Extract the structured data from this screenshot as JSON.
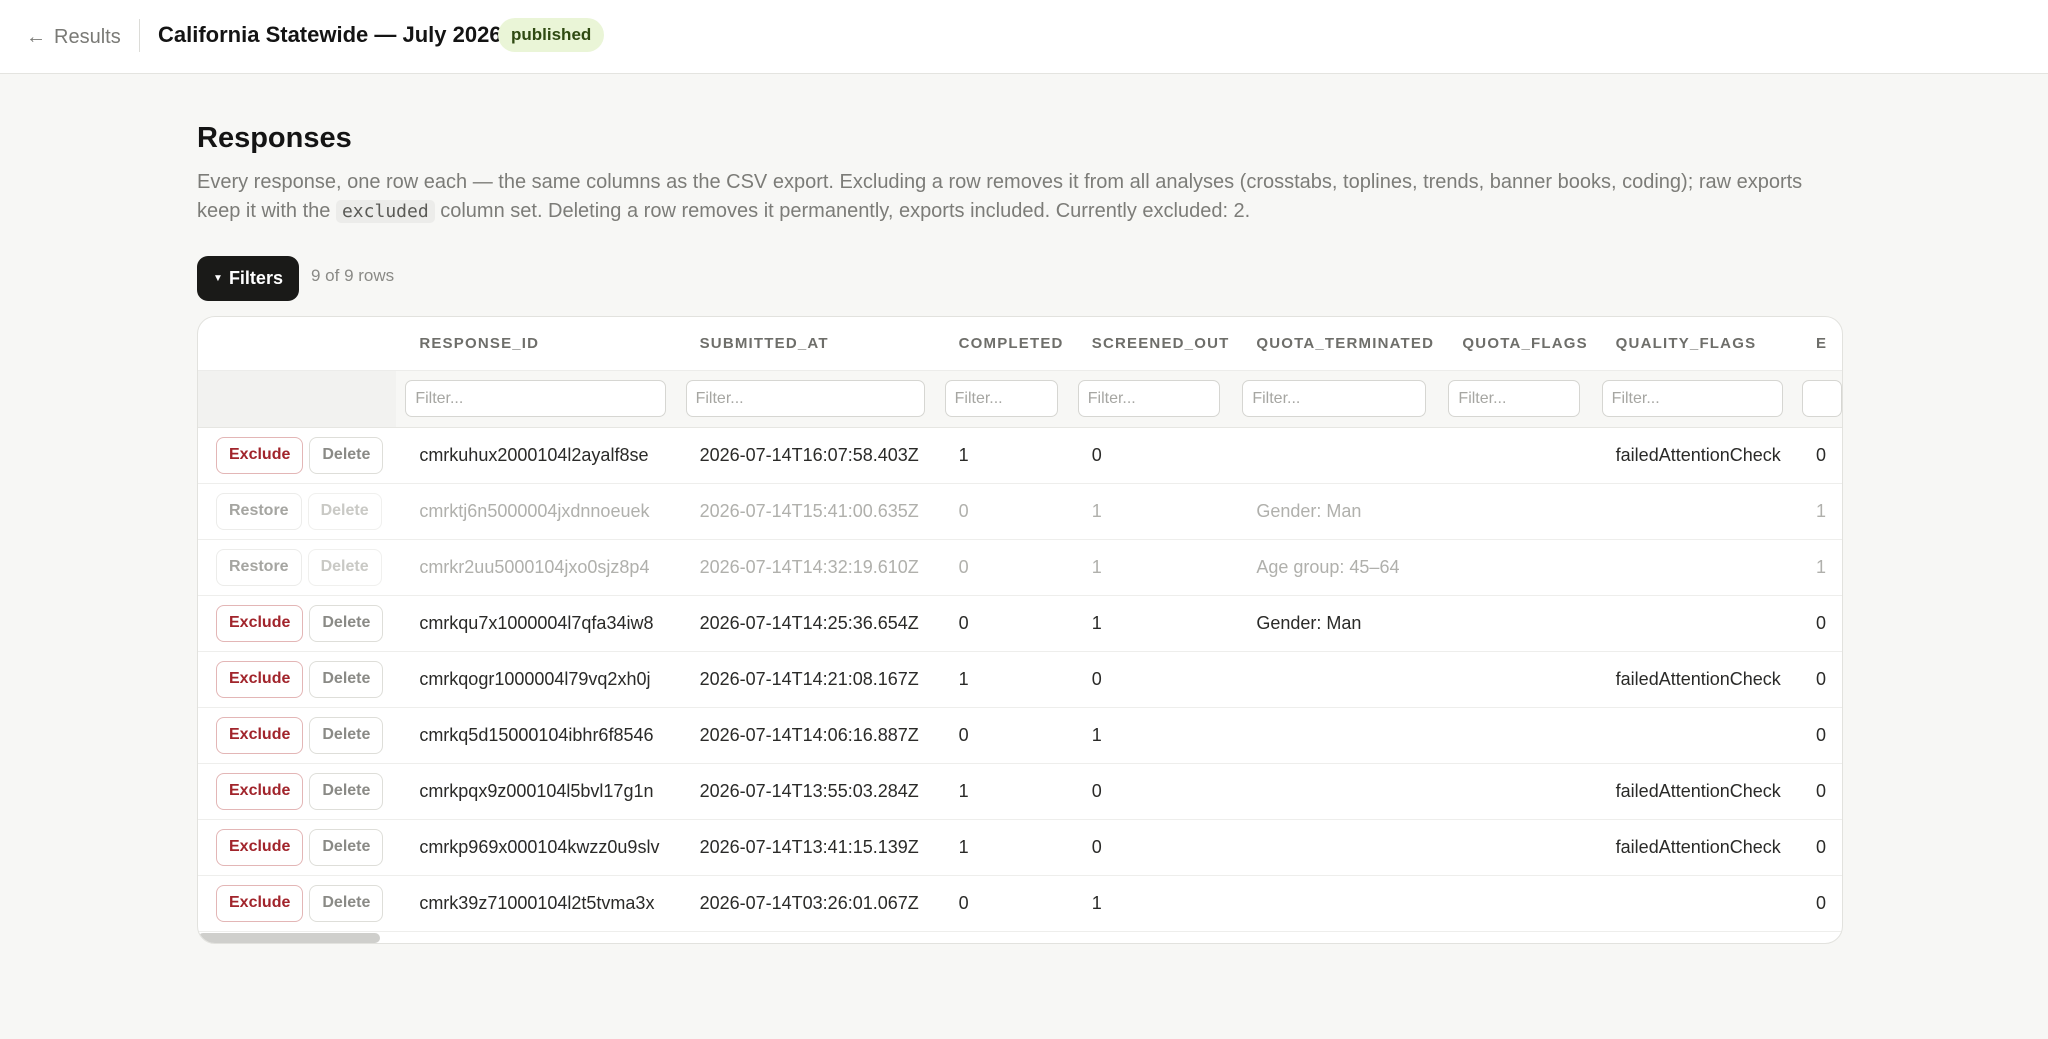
{
  "header": {
    "back_label": "Results",
    "survey_title": "California Statewide — July 2026",
    "status": "published"
  },
  "page": {
    "title": "Responses",
    "desc_part1": "Every response, one row each — the same columns as the CSV export. Excluding a row removes it from all analyses (crosstabs, toplines, trends, banner books, coding); raw exports keep it with the ",
    "desc_code": "excluded",
    "desc_part2": " column set. Deleting a row removes it permanently, exports included. Currently excluded: 2."
  },
  "toolbar": {
    "filters_label": "Filters",
    "row_count": "9 of 9 rows"
  },
  "table": {
    "columns": [
      "RESPONSE_ID",
      "SUBMITTED_AT",
      "COMPLETED",
      "SCREENED_OUT",
      "QUOTA_TERMINATED",
      "QUOTA_FLAGS",
      "QUALITY_FLAGS",
      "E"
    ],
    "filter_placeholder": "Filter...",
    "exclude_label": "Exclude",
    "restore_label": "Restore",
    "delete_label": "Delete",
    "rows": [
      {
        "response_id": "cmrkuhux2000104l2ayalf8se",
        "submitted_at": "2026-07-14T16:07:58.403Z",
        "completed": "1",
        "screened_out": "0",
        "quota_terminated": "",
        "quota_flags": "",
        "quality_flags": "failedAttentionCheck",
        "e": "0",
        "excluded": false
      },
      {
        "response_id": "cmrktj6n5000004jxdnnoeuek",
        "submitted_at": "2026-07-14T15:41:00.635Z",
        "completed": "0",
        "screened_out": "1",
        "quota_terminated": "Gender: Man",
        "quota_flags": "",
        "quality_flags": "",
        "e": "1",
        "excluded": true
      },
      {
        "response_id": "cmrkr2uu5000104jxo0sjz8p4",
        "submitted_at": "2026-07-14T14:32:19.610Z",
        "completed": "0",
        "screened_out": "1",
        "quota_terminated": "Age group: 45–64",
        "quota_flags": "",
        "quality_flags": "",
        "e": "1",
        "excluded": true
      },
      {
        "response_id": "cmrkqu7x1000004l7qfa34iw8",
        "submitted_at": "2026-07-14T14:25:36.654Z",
        "completed": "0",
        "screened_out": "1",
        "quota_terminated": "Gender: Man",
        "quota_flags": "",
        "quality_flags": "",
        "e": "0",
        "excluded": false
      },
      {
        "response_id": "cmrkqogr1000004l79vq2xh0j",
        "submitted_at": "2026-07-14T14:21:08.167Z",
        "completed": "1",
        "screened_out": "0",
        "quota_terminated": "",
        "quota_flags": "",
        "quality_flags": "failedAttentionCheck",
        "e": "0",
        "excluded": false
      },
      {
        "response_id": "cmrkq5d15000104ibhr6f8546",
        "submitted_at": "2026-07-14T14:06:16.887Z",
        "completed": "0",
        "screened_out": "1",
        "quota_terminated": "",
        "quota_flags": "",
        "quality_flags": "",
        "e": "0",
        "excluded": false
      },
      {
        "response_id": "cmrkpqx9z000104l5bvl17g1n",
        "submitted_at": "2026-07-14T13:55:03.284Z",
        "completed": "1",
        "screened_out": "0",
        "quota_terminated": "",
        "quota_flags": "",
        "quality_flags": "failedAttentionCheck",
        "e": "0",
        "excluded": false
      },
      {
        "response_id": "cmrkp969x000104kwzz0u9slv",
        "submitted_at": "2026-07-14T13:41:15.139Z",
        "completed": "1",
        "screened_out": "0",
        "quota_terminated": "",
        "quota_flags": "",
        "quality_flags": "failedAttentionCheck",
        "e": "0",
        "excluded": false
      },
      {
        "response_id": "cmrk39z71000104l2t5tvma3x",
        "submitted_at": "2026-07-14T03:26:01.067Z",
        "completed": "0",
        "screened_out": "1",
        "quota_terminated": "",
        "quota_flags": "",
        "quality_flags": "",
        "e": "0",
        "excluded": false
      }
    ]
  },
  "colors": {
    "accent_dark": "#1a1a18",
    "exclude_red": "#a1242b",
    "badge_bg": "#eaf5d7"
  },
  "icons": {
    "back": "arrow-left-icon",
    "filters_caret": "caret-down-icon"
  }
}
